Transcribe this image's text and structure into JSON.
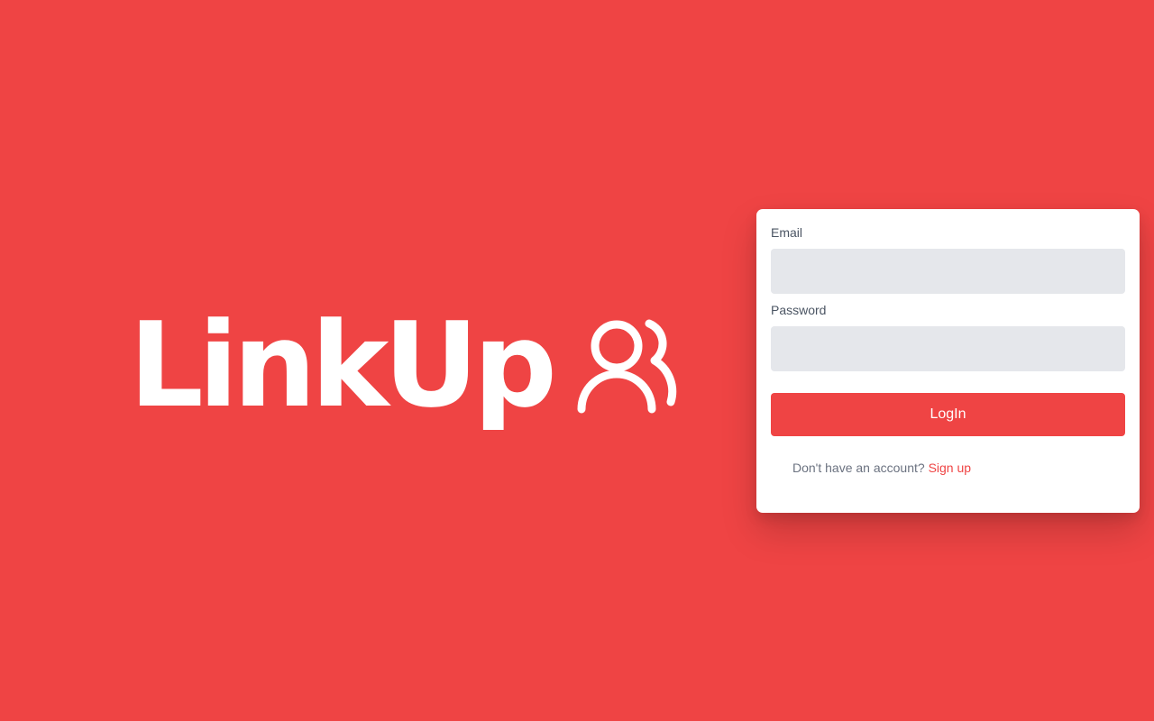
{
  "brand": {
    "name": "LinkUp",
    "icon": "users-icon"
  },
  "login_form": {
    "email_label": "Email",
    "email_value": "",
    "password_label": "Password",
    "password_value": "",
    "submit_label": "LogIn",
    "signup_prompt": "Don't have an account?",
    "signup_link": "Sign up"
  },
  "colors": {
    "background": "#ef4444",
    "accent": "#ef4444",
    "input_background": "#e5e7eb",
    "card_background": "#ffffff"
  }
}
